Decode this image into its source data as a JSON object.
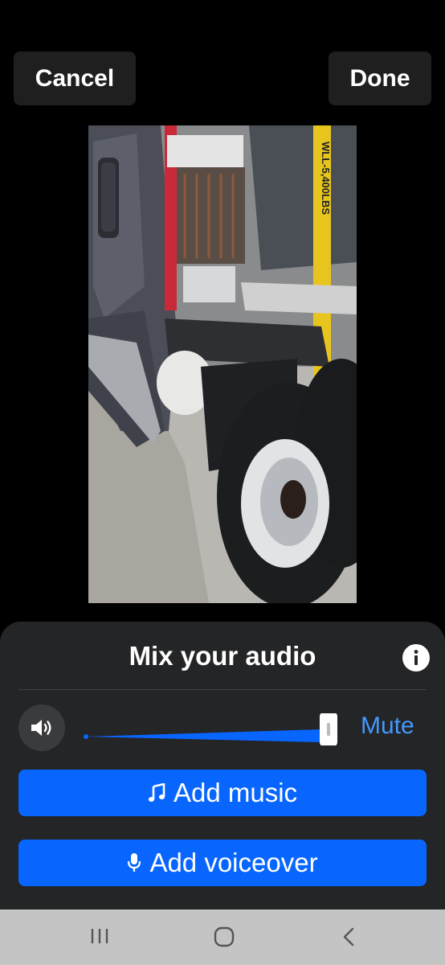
{
  "header": {
    "cancel_label": "Cancel",
    "done_label": "Done"
  },
  "audio_sheet": {
    "title": "Mix your audio",
    "volume_level": 1.0,
    "mute_label": "Mute",
    "add_music_label": "Add music",
    "add_voiceover_label": "Add voiceover"
  },
  "preview": {
    "truck_strap_text": "WLL-5,400LBS"
  },
  "colors": {
    "accent_blue": "#0866ff",
    "mute_text": "#4599ff",
    "sheet_bg": "#242526",
    "nav_bar": "#c4c4c4"
  },
  "icons": {
    "info": "info-icon",
    "volume": "speaker-icon",
    "music": "music-note-icon",
    "voiceover": "microphone-icon",
    "recents": "recents-icon",
    "home": "home-icon",
    "back": "back-icon"
  }
}
